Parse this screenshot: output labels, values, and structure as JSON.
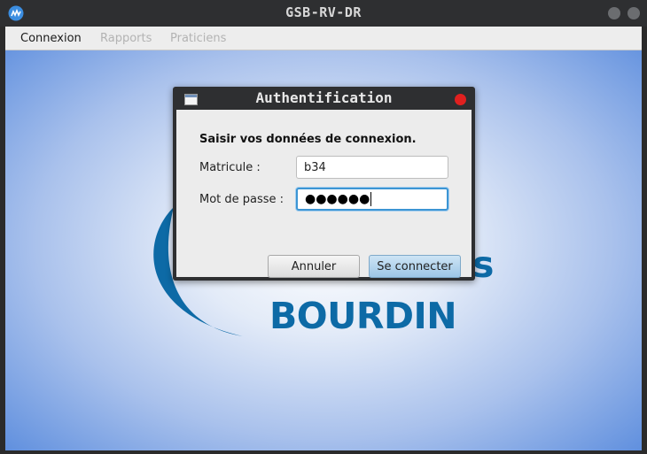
{
  "window": {
    "title": "GSB-RV-DR",
    "icon": "app-launcher-icon"
  },
  "menubar": {
    "items": [
      {
        "label": "Connexion",
        "enabled": true
      },
      {
        "label": "Rapports",
        "enabled": false
      },
      {
        "label": "Praticiens",
        "enabled": false
      }
    ]
  },
  "background": {
    "logo_text": "BOURDIN",
    "logo_fragment": "s"
  },
  "dialog": {
    "title": "Authentification",
    "prompt": "Saisir vos données de connexion.",
    "matricule_label": "Matricule :",
    "matricule_value": "b34",
    "password_label": "Mot de passe :",
    "password_masked": "●●●●●●",
    "cancel_label": "Annuler",
    "connect_label": "Se connecter"
  },
  "colors": {
    "titlebar": "#2e2f31",
    "accent_focus": "#3c95d4",
    "logo_blue": "#0d6aa6",
    "close_red": "#e0201f"
  }
}
